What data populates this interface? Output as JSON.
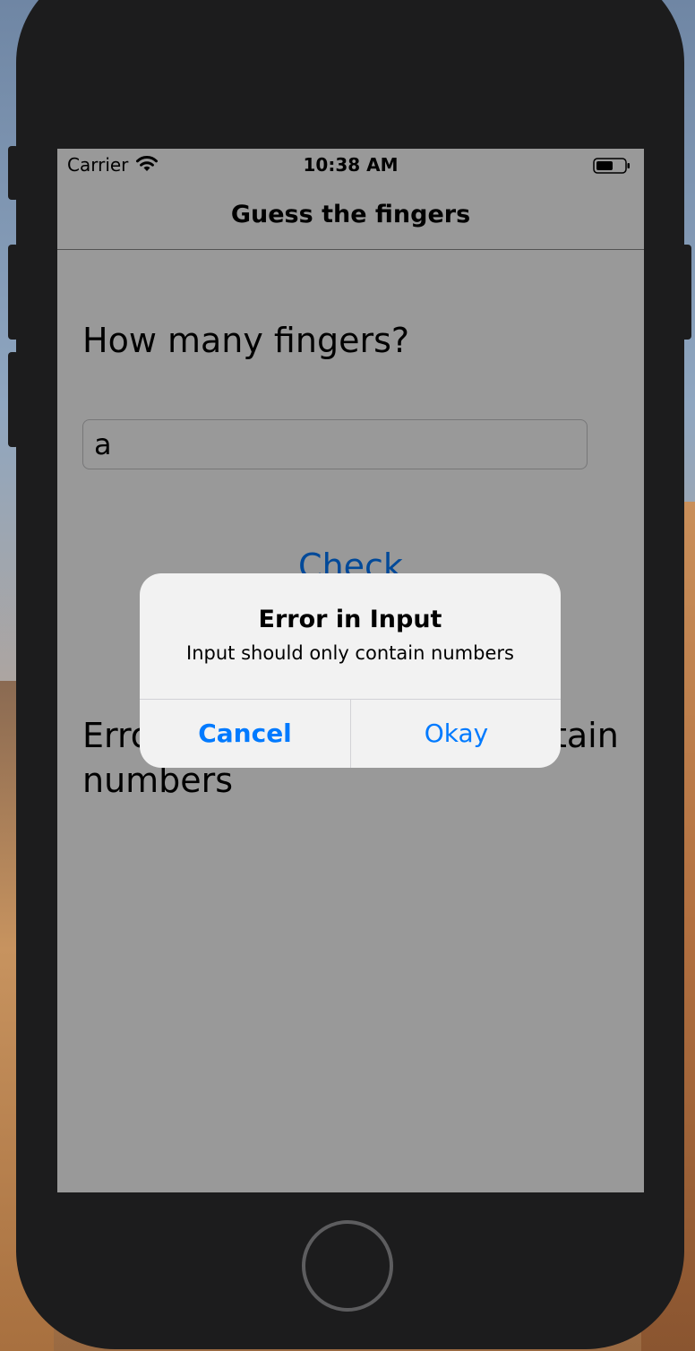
{
  "status_bar": {
    "carrier": "Carrier",
    "time": "10:38 AM",
    "wifi_icon": "wifi-icon",
    "battery_icon": "battery-icon"
  },
  "nav": {
    "title": "Guess the fingers"
  },
  "main": {
    "question": "How many fingers?",
    "input_value": "a",
    "check_label": "Check",
    "result_text": "Error: Input should only contain numbers"
  },
  "alert": {
    "title": "Error in Input",
    "message": "Input should only contain numbers",
    "cancel_label": "Cancel",
    "okay_label": "Okay"
  },
  "colors": {
    "accent": "#007aff",
    "device_frame": "#1c1c1d",
    "dim_overlay": "rgba(0,0,0,0.40)"
  }
}
